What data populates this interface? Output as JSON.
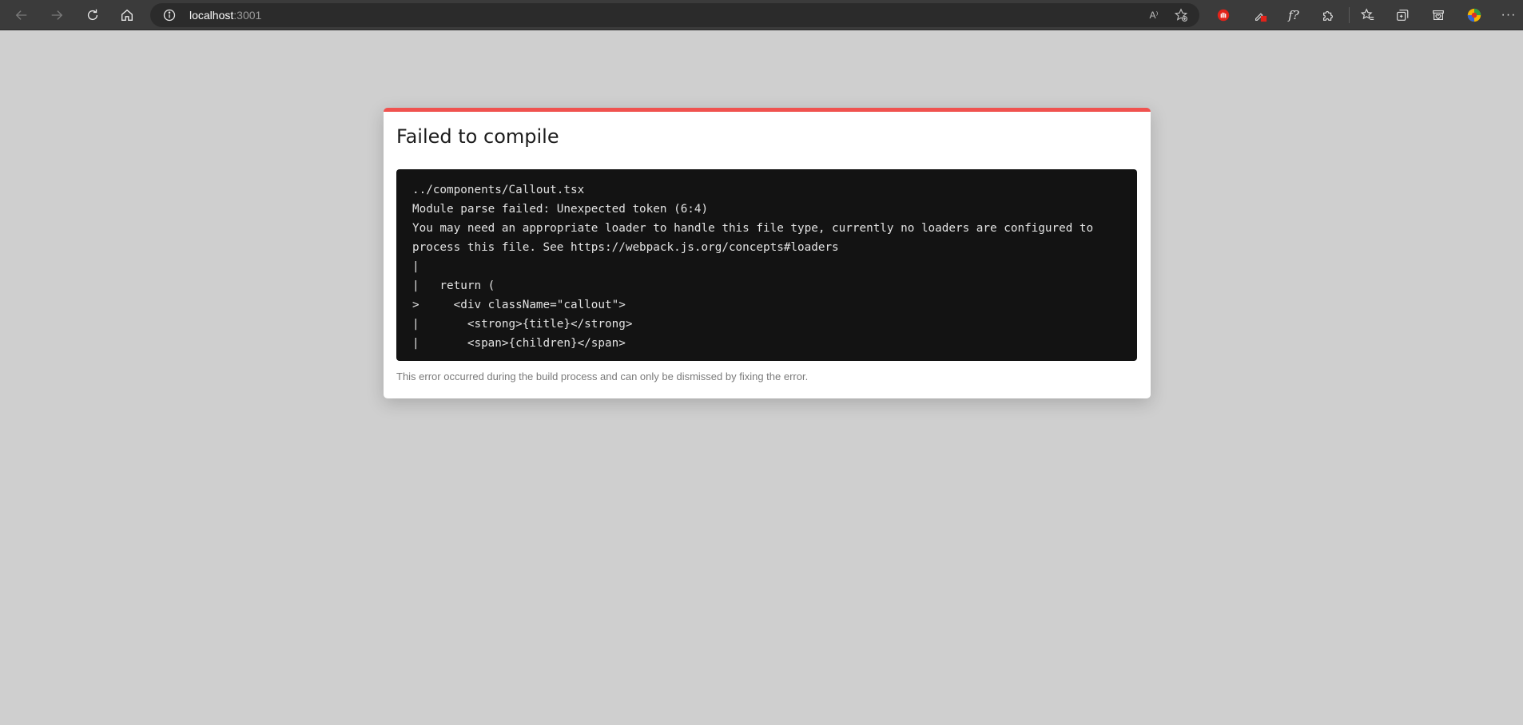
{
  "browser": {
    "url_host": "localhost",
    "url_port": ":3001",
    "read_aloud_label": "A⁾",
    "formula_label": "f?",
    "menu_label": "···"
  },
  "error": {
    "title": "Failed to compile",
    "code_lines": [
      "../components/Callout.tsx",
      "Module parse failed: Unexpected token (6:4)",
      "You may need an appropriate loader to handle this file type, currently no loaders are configured to",
      "process this file. See https://webpack.js.org/concepts#loaders",
      "|",
      "|   return (",
      ">     <div className=\"callout\">",
      "|       <strong>{title}</strong>",
      "|       <span>{children}</span>"
    ],
    "footer": "This error occurred during the build process and can only be dismissed by fixing the error."
  },
  "colors": {
    "accent": "#f0524f",
    "background": "#cfcfcf",
    "code_background": "#131313"
  },
  "icons": [
    "back-arrow-icon",
    "forward-arrow-icon",
    "refresh-icon",
    "home-icon",
    "info-icon",
    "read-aloud-icon",
    "favorite-add-icon",
    "stop-hand-icon",
    "extension-icon",
    "formula-icon",
    "puzzle-icon",
    "favorites-icon",
    "collections-icon",
    "browser-essentials-icon",
    "profile-avatar-icon",
    "more-menu-icon"
  ]
}
